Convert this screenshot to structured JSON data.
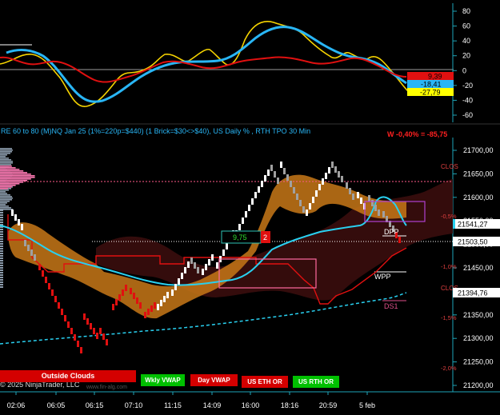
{
  "upper_panel": {
    "y_ticks": [
      "80",
      "60",
      "40",
      "20",
      "0",
      "-20",
      "-40",
      "-60"
    ],
    "value_badges": [
      {
        "text": "9,39",
        "bg": "#e01010",
        "fg": "#000000"
      },
      {
        "text": "-18,41",
        "bg": "#29b6f6",
        "fg": "#000000"
      },
      {
        "text": "-27,79",
        "bg": "#ffff00",
        "fg": "#000000"
      }
    ],
    "colors": {
      "yellow_line": "#f5d300",
      "blue_line": "#29b6f6",
      "red_line": "#e01010"
    }
  },
  "lower_panel": {
    "title": "RE 60 to 80 (M)NQ Jan 25 (1%=220p=$440) (1 Brick=$30<>$40), US Daily % , RTH TPO 30 Min",
    "stat": "W -0,40% = -85,75",
    "y_ticks": [
      "21700,00",
      "21650,00",
      "21600,00",
      "21550,00",
      "21500,00",
      "21450,00",
      "21400,00",
      "21350,00",
      "21300,00",
      "21250,00",
      "21200,00"
    ],
    "price_badges": [
      {
        "text": "21541,27",
        "bg": "#ffffff",
        "fg": "#000000"
      },
      {
        "text": "21503,50",
        "bg": "#ffffff",
        "fg": "#000000"
      },
      {
        "text": "21394,76",
        "bg": "#ffffff",
        "fg": "#000000"
      }
    ],
    "percent_labels": [
      "-0,5%",
      "-1,0%",
      "-1,5%",
      "-2,0%"
    ],
    "level_labels": [
      "CLOS",
      "CLOS",
      "DPP",
      "WPP",
      "DS1"
    ],
    "box_label_value": "9,75",
    "box_label_count": "2",
    "x_ticks": [
      "02:06",
      "06:05",
      "06:15",
      "07:10",
      "11:15",
      "14:09",
      "16:00",
      "18:16",
      "20:59",
      "5 feb"
    ]
  },
  "buttons": [
    {
      "label": "Outside Clouds",
      "bg": "#d40000"
    },
    {
      "label": "Wkly VWAP",
      "bg": "#00c000"
    },
    {
      "label": "Day VWAP",
      "bg": "#d40000"
    },
    {
      "label": "US ETH OR",
      "bg": "#d40000"
    },
    {
      "label": "US RTH OR",
      "bg": "#00c000"
    }
  ],
  "copyright": "© 2025 NinjaTrader, LLC",
  "watermark": "www.fin-alg.com"
}
